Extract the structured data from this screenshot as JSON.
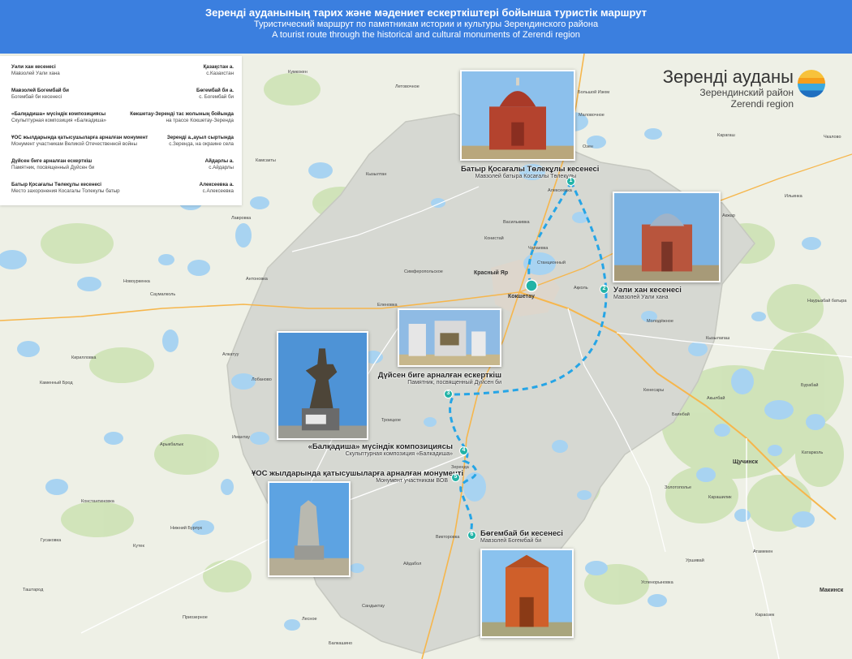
{
  "header": {
    "title_kz": "Зеренді ауданының тарих және мәдениет ескерткіштері бойынша туристік маршрут",
    "title_ru": "Туристический маршрут по памятникам истории и культуры Зерендинского района",
    "title_en": "A tourist route through the historical and cultural monuments of  Zerendi region"
  },
  "legend": [
    {
      "kz": "Уәли хан кесенесі",
      "ru": "Мавзолей Уали хана",
      "loc_kz": "Қазақстан а.",
      "loc_ru": "с.Казахстан"
    },
    {
      "kz": "Мавзолей Богембай би",
      "ru": "Богембай би кесенесі",
      "loc_kz": "Бөгембай би а.",
      "loc_ru": "с. Богембай би"
    },
    {
      "kz": "«Балқадиша» мүсіндік композициясы",
      "ru": "Скульптурная композиция «Балкадиша»",
      "loc_kz": "Көкшетау-Зеренді тас жолының бойында",
      "loc_ru": "на трассе Кокшетау-Зеренда"
    },
    {
      "kz": "ҰОС жылдарында қатысушыларға арналған монумент",
      "ru": "Монумент участникам Великой Отечественной войны",
      "loc_kz": "Зеренді а.,ауыл сыртында",
      "loc_ru": "с.Зеренда, на окраине села"
    },
    {
      "kz": "Дүйсен биге арналған ескерткіш",
      "ru": "Памятник, посвященный Дуйсен би",
      "loc_kz": "Айдарлы а.",
      "loc_ru": "с.Айдарлы"
    },
    {
      "kz": "Батыр Қосағалы Төлекұлы кесенесі",
      "ru": "Место захоронения Косагалы Толекулы батыр",
      "loc_kz": "Алексеевка а.",
      "loc_ru": "с.Алексеевка"
    }
  ],
  "region": {
    "kz": "Зеренді ауданы",
    "ru": "Зерендинский район",
    "en": "Zerendi region"
  },
  "sites": [
    {
      "num": "1",
      "kz": "Батыр Қосағалы Төлекұлы кесенесі",
      "ru": "Мавзолей батыра Косағалы Төлекұлы"
    },
    {
      "num": "2",
      "kz": "Уәли хан кесенесі",
      "ru": "Мавзолей Уали хана"
    },
    {
      "num": "3",
      "kz": "Дүйсен биге арналған ескерткіш",
      "ru": "Памятник, посвященный Дуйсен би"
    },
    {
      "num": "4",
      "kz": "«Балқадиша» мүсіндік композициясы",
      "ru": "Скульптурная композиция «Балкадиша»"
    },
    {
      "num": "5",
      "kz": "ҰОС жылдарында қатысушыларға арналған монументі",
      "ru": "Монумент участникам ВОВ"
    },
    {
      "num": "6",
      "kz": "Бөгембай би кесенесі",
      "ru": "Мавзолей Богембай би"
    }
  ],
  "cities": {
    "kokshetau": "Кокшетау",
    "krasny_yar": "Красный Яр",
    "shchuchinsk": "Щучинск",
    "makinsk": "Макинск",
    "zerenda": "Зеренда"
  },
  "towns": [
    "Кумкокен",
    "Летовочное",
    "Большой Изюм",
    "Маловочное",
    "Карагаш",
    "Чкалово",
    "Камсакты",
    "Кызылтан",
    "Алексеевка",
    "Озен",
    "Ильинка",
    "Акжар",
    "Лавровка",
    "Василькивка",
    "Конистай",
    "Чапаевка",
    "Станционный",
    "Антоновка",
    "Симферопольское",
    "Новоуркенка",
    "Саумалколь",
    "Ақколь",
    "Молодёжное",
    "Наурызбай батыра",
    "Кызылагаш",
    "Еленовка",
    "Алкатуу",
    "Кирилловка",
    "Лобаново",
    "Каменный Брод",
    "Кенесары",
    "Бурабай",
    "Акылбай",
    "Баянбай",
    "Троицкое",
    "Арыкбалык",
    "Имантау",
    "Катарколь",
    "Золотополье",
    "Карашилик",
    "Константиновка",
    "Нижний Бурлук",
    "Гусаковка",
    "Кутек",
    "Викторовка",
    "Айдабол",
    "Уршивай",
    "Атамекен",
    "Успенорыновка",
    "Таштарод",
    "Сандыктау",
    "Приозерное",
    "Лесное",
    "Балкашино",
    "Караозек"
  ]
}
